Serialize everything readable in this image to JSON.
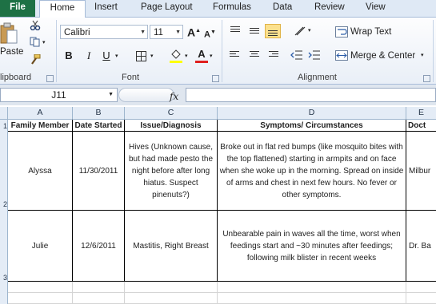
{
  "ribbon_tabs": [
    "File",
    "Home",
    "Insert",
    "Page Layout",
    "Formulas",
    "Data",
    "Review",
    "View"
  ],
  "clipboard": {
    "paste_label": "Paste",
    "group_label": "lipboard"
  },
  "font": {
    "family": "Calibri",
    "size": "11",
    "grow": "A",
    "shrink": "A",
    "bold": "B",
    "italic": "I",
    "underline": "U",
    "group_label": "Font",
    "highlight_color": "#ffff00",
    "font_color": "#e0201f"
  },
  "alignment": {
    "wrap_text": "Wrap Text",
    "merge_center": "Merge & Center",
    "group_label": "Alignment"
  },
  "formula_bar": {
    "name_box": "J11",
    "fx": "fx",
    "formula": ""
  },
  "columns": [
    "A",
    "B",
    "C",
    "D",
    "E"
  ],
  "row_numbers": [
    "1",
    "2",
    "3"
  ],
  "table": {
    "headers": [
      "Family Member",
      "Date Started",
      "Issue/Diagnosis",
      "Symptoms/ Circumstances",
      "Doct"
    ],
    "rows": [
      [
        "Alyssa",
        "11/30/2011",
        "Hives (Unknown cause, but had made pesto the night before after long hiatus.  Suspect pinenuts?)",
        "Broke out in flat red bumps (like mosquito bites with the top flattened) starting in armpits and on face when she woke up in the morning.  Spread on inside of arms and chest in next few hours.  No fever or other symptoms.",
        "Milbur"
      ],
      [
        "Julie",
        "12/6/2011",
        "Mastitis, Right Breast",
        "Unbearable pain in waves all the time, worst when feedings start and ~30 minutes after feedings; following milk blister in recent weeks",
        "Dr. Ba"
      ]
    ]
  }
}
